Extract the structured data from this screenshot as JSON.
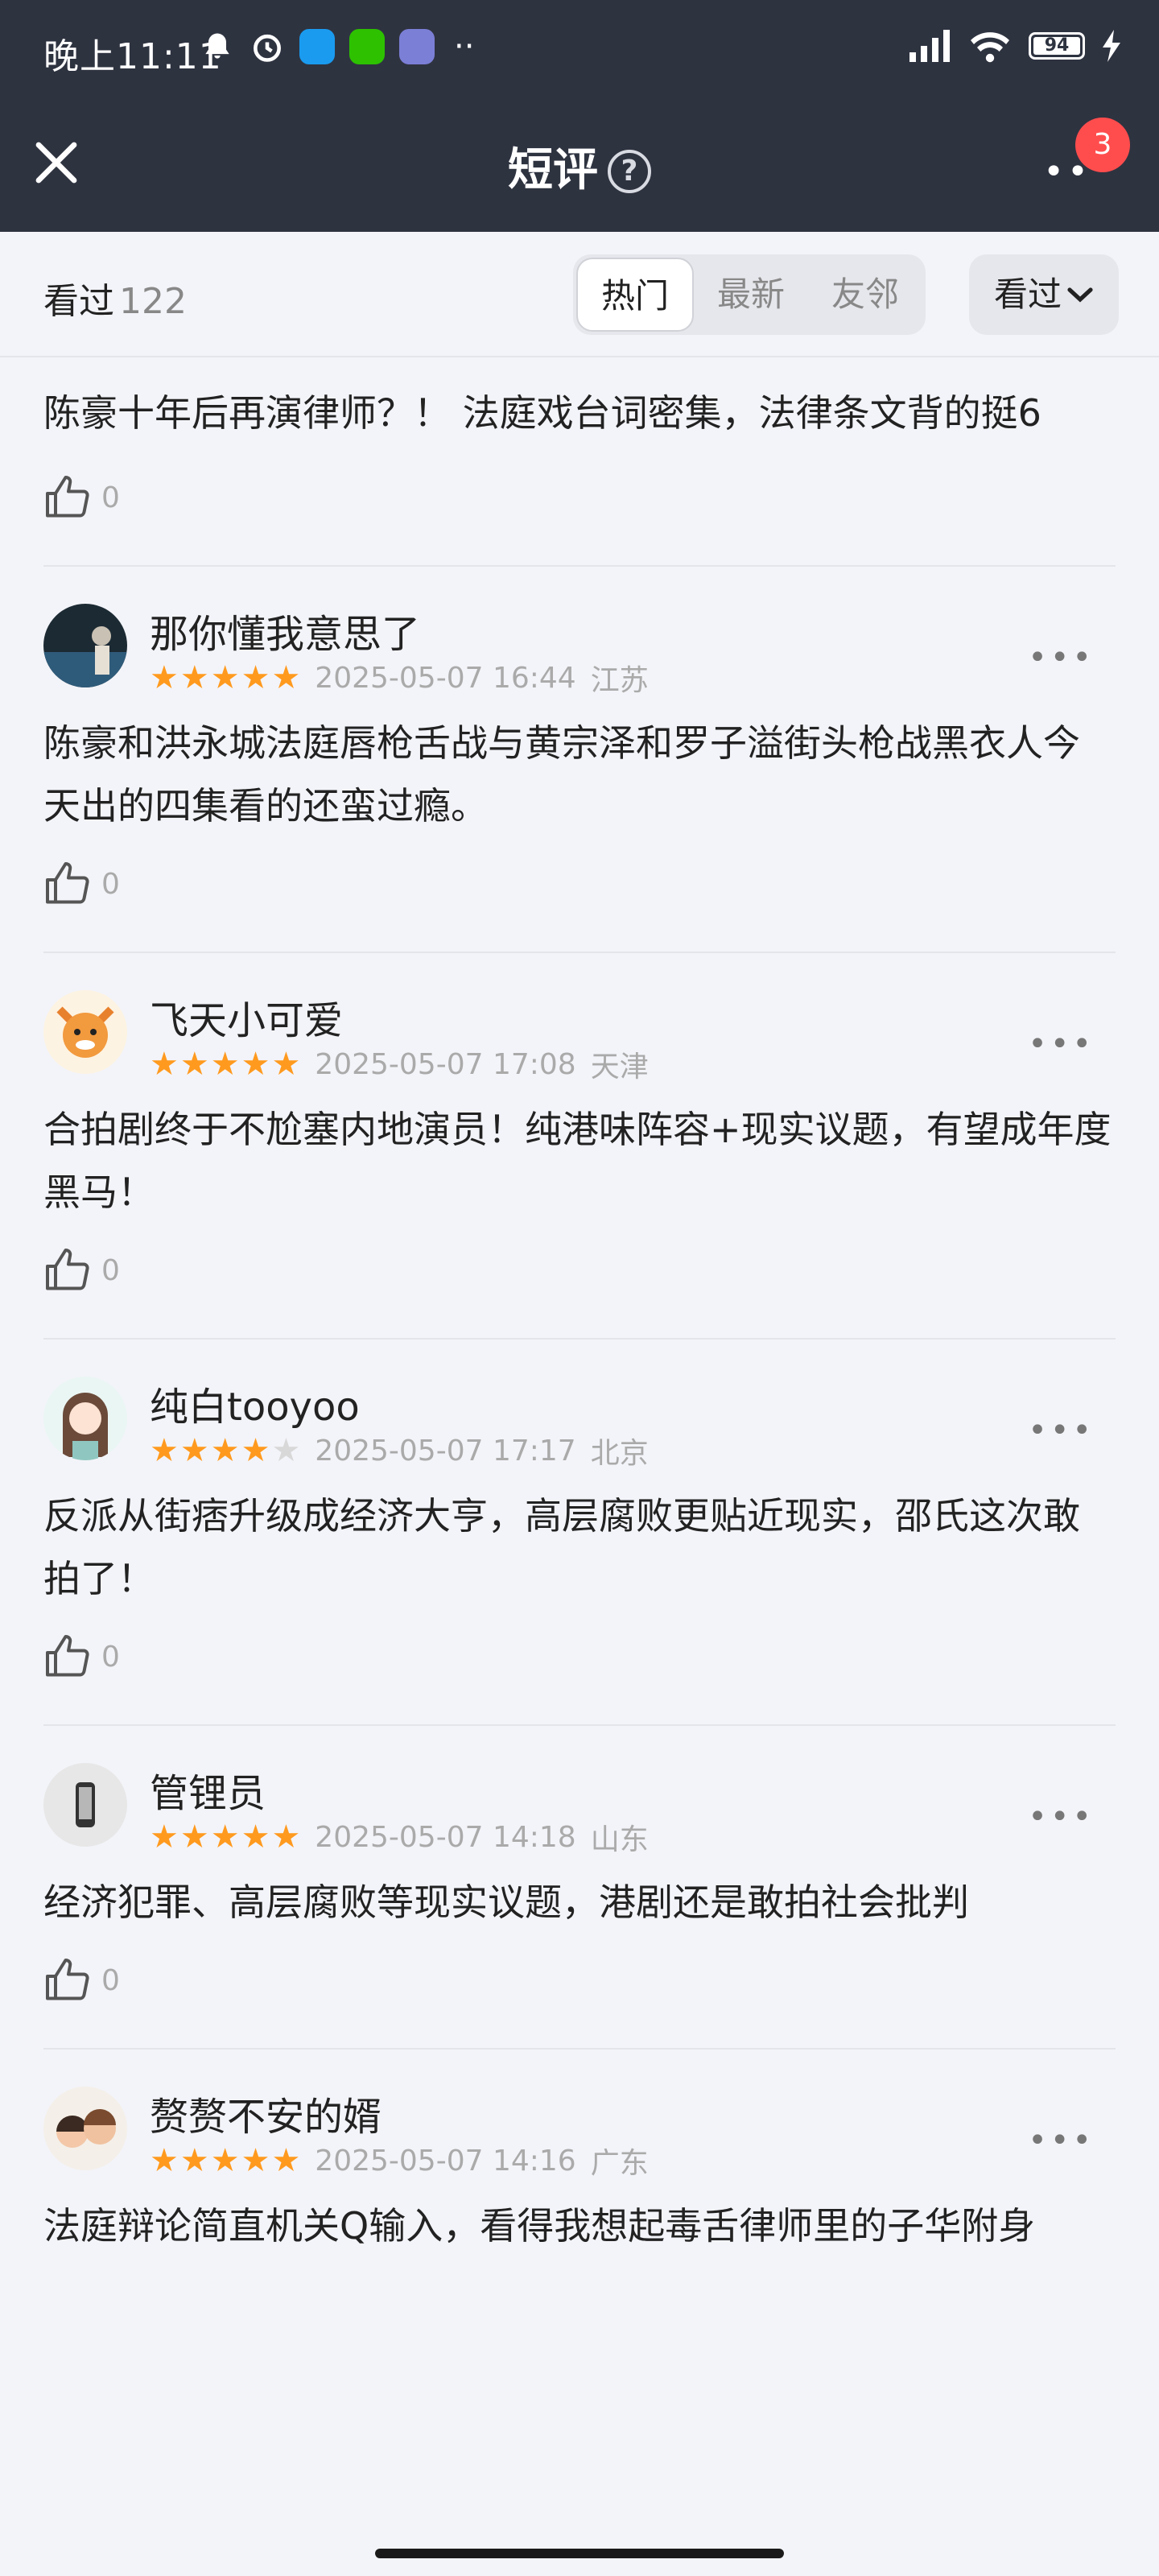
{
  "status_bar": {
    "time": "晚上11:11",
    "battery": "94"
  },
  "nav": {
    "title": "短评",
    "help_icon": "?",
    "badge": "3"
  },
  "filter": {
    "seen_label": "看过",
    "seen_count": "122",
    "tabs": [
      "热门",
      "最新",
      "友邻"
    ],
    "active_tab": "热门",
    "dropdown_label": "看过"
  },
  "first_review": {
    "text": "陈豪十年后再演律师？！ 法庭戏台词密集，法律条文背的挺6",
    "likes": "0"
  },
  "reviews": [
    {
      "user": "那你懂我意思了",
      "rating": 5,
      "date": "2025-05-07 16:44",
      "region": "江苏",
      "text": "陈豪和洪永城法庭唇枪舌战与黄宗泽和罗子溢街头枪战黑衣人今天出的四集看的还蛮过瘾。",
      "likes": "0"
    },
    {
      "user": "飞天小可爱",
      "rating": 5,
      "date": "2025-05-07 17:08",
      "region": "天津",
      "text": "合拍剧终于不尬塞内地演员！纯港味阵容+现实议题，有望成年度黑马！",
      "likes": "0"
    },
    {
      "user": "纯白tooyoo",
      "rating": 4,
      "date": "2025-05-07 17:17",
      "region": "北京",
      "text": "反派从街痞升级成经济大亨，高层腐败更贴近现实，邵氏这次敢拍了！",
      "likes": "0"
    },
    {
      "user": "管锂员",
      "rating": 5,
      "date": "2025-05-07 14:18",
      "region": "山东",
      "text": "经济犯罪、高层腐败等现实议题，港剧还是敢拍社会批判",
      "likes": "0"
    },
    {
      "user": "赘赘不安的婿",
      "rating": 5,
      "date": "2025-05-07 14:16",
      "region": "广东",
      "text": "法庭辩论简直机关Q输入，看得我想起毒舌律师里的子华附身",
      "likes": ""
    }
  ],
  "colors": {
    "nav_bg": "#2e3340",
    "page_bg": "#f3f4f9",
    "star": "#ff9a1f",
    "badge": "#ff4d4d"
  }
}
